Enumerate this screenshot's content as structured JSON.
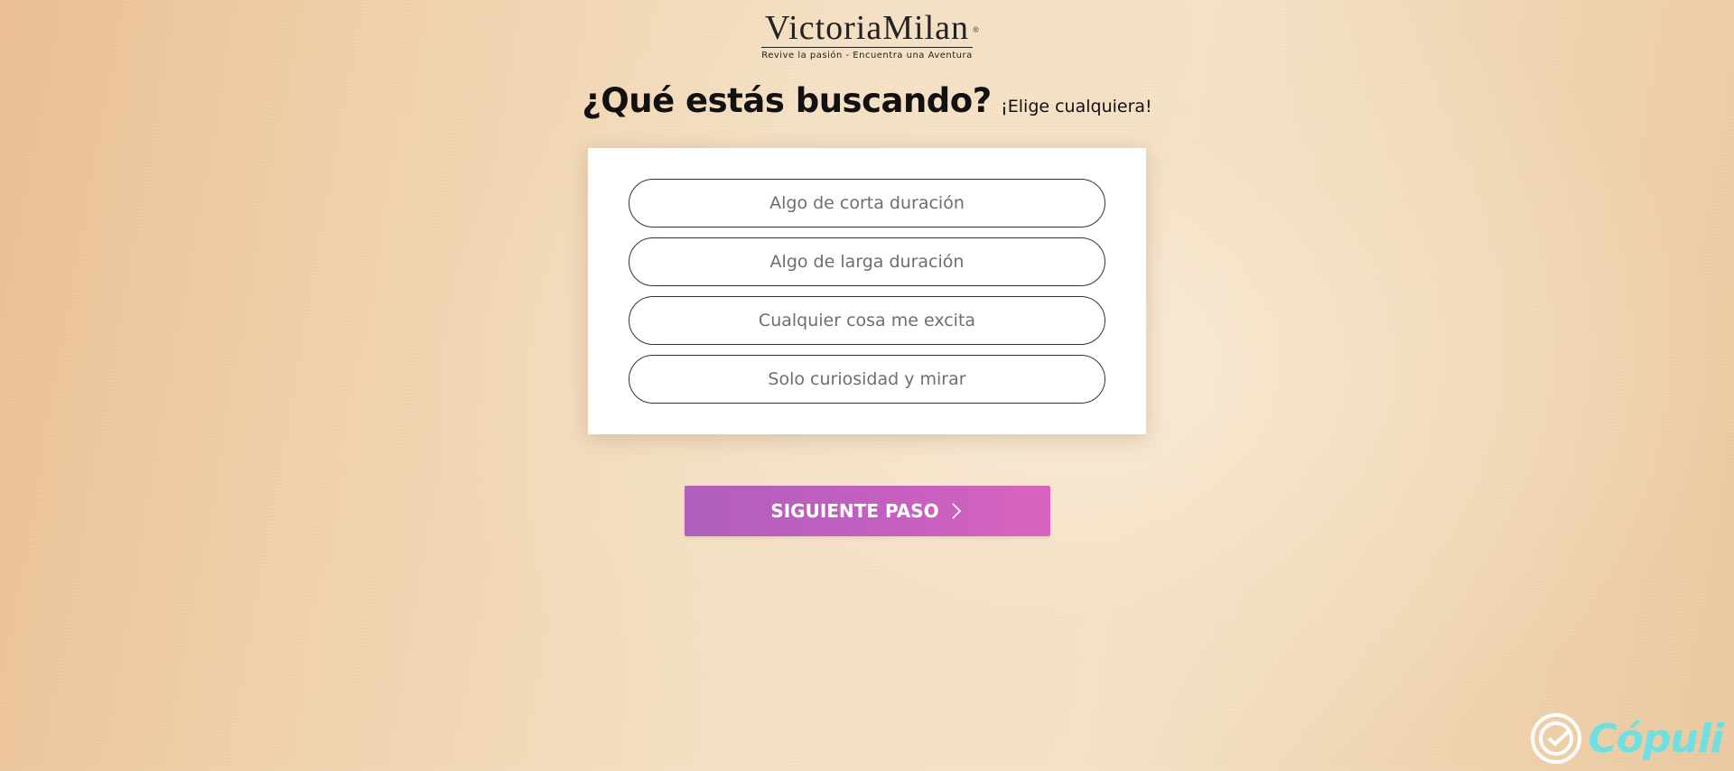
{
  "logo": {
    "name": "VictoriaMilan",
    "registered": "®",
    "tagline": "Revive la pasión - Encuentra una Aventura"
  },
  "heading": {
    "title": "¿Qué estás buscando?",
    "subtitle": "¡Elige cualquiera!"
  },
  "options": [
    {
      "label": "Algo de corta duración"
    },
    {
      "label": "Algo de larga duración"
    },
    {
      "label": "Cualquier cosa me excita"
    },
    {
      "label": "Solo curiosidad y mirar"
    }
  ],
  "next_button": {
    "label": "SIGUIENTE PASO",
    "icon": "chevron-right-icon"
  },
  "watermark": {
    "text": "Cópuli",
    "icon": "copuli-logo-icon"
  },
  "colors": {
    "button_gradient_start": "#b05fbd",
    "button_gradient_end": "#d963bf",
    "watermark": "#6ee0e3"
  }
}
